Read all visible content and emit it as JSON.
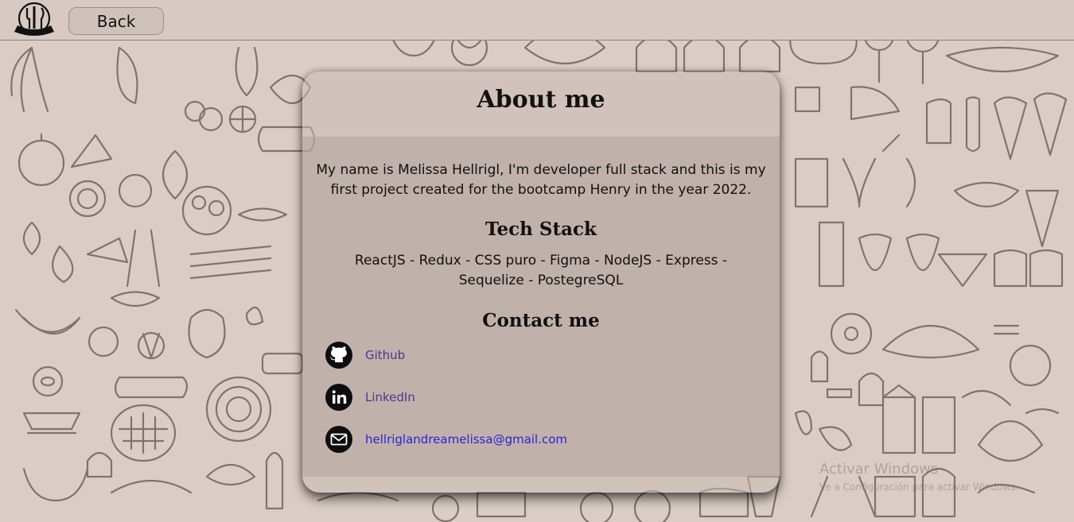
{
  "header": {
    "back_label": "Back"
  },
  "card": {
    "title": "About me",
    "bio": "My name is Melissa Hellrigl, I'm developer full stack and this is my first project created for the bootcamp Henry in the year 2022.",
    "tech_title": "Tech Stack",
    "tech_stack": "ReactJS - Redux - CSS puro - Figma - NodeJS - Express - Sequelize - PostegreSQL",
    "contact_title": "Contact me",
    "contacts": [
      {
        "icon": "github-icon",
        "label": "Github"
      },
      {
        "icon": "linkedin-icon",
        "label": "LinkedIn"
      },
      {
        "icon": "mail-icon",
        "label": "hellriglandreamelissa@gmail.com"
      }
    ]
  },
  "watermark": {
    "line1": "Activar Windows",
    "line2": "Ve a Configuración para activar Windows."
  },
  "colors": {
    "background": "#dbcdc6",
    "link_visited": "#5a2e8c",
    "link_mail": "#2a23d6"
  }
}
